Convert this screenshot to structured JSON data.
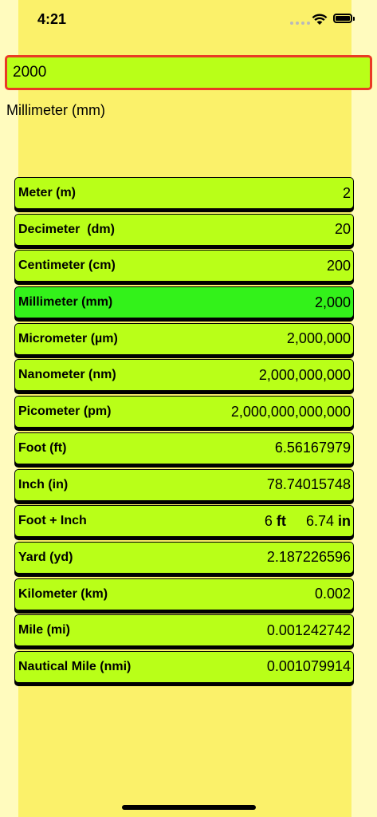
{
  "status_bar": {
    "time": "4:21"
  },
  "input": {
    "value": "2000"
  },
  "selected_unit": "Millimeter (mm)",
  "conversions": [
    {
      "label": "Meter (m)",
      "value": "2"
    },
    {
      "label": "Decimeter  (dm)",
      "value": "20"
    },
    {
      "label": "Centimeter (cm)",
      "value": "200"
    },
    {
      "label": "Millimeter (mm)",
      "value": "2,000",
      "active": true
    },
    {
      "label": "Micrometer (µm)",
      "value": "2,000,000"
    },
    {
      "label": "Nanometer (nm)",
      "value": "2,000,000,000"
    },
    {
      "label": "Picometer (pm)",
      "value": "2,000,000,000,000"
    },
    {
      "label": "Foot (ft)",
      "value": "6.56167979"
    },
    {
      "label": "Inch (in)",
      "value": "78.74015748"
    },
    {
      "label": "Foot + Inch",
      "feet": "6",
      "feet_unit": "ft",
      "inches": "6.74",
      "inches_unit": "in"
    },
    {
      "label": "Yard (yd)",
      "value": "2.187226596"
    },
    {
      "label": "Kilometer (km)",
      "value": "0.002"
    },
    {
      "label": "Mile (mi)",
      "value": "0.001242742"
    },
    {
      "label": "Nautical Mile (nmi)",
      "value": "0.001079914"
    }
  ],
  "colors": {
    "row_bg": "#b9ff18",
    "row_active_bg": "#33f21a",
    "input_border": "#ea3a25",
    "band": "#fbf16a",
    "page": "#fffbbe"
  }
}
